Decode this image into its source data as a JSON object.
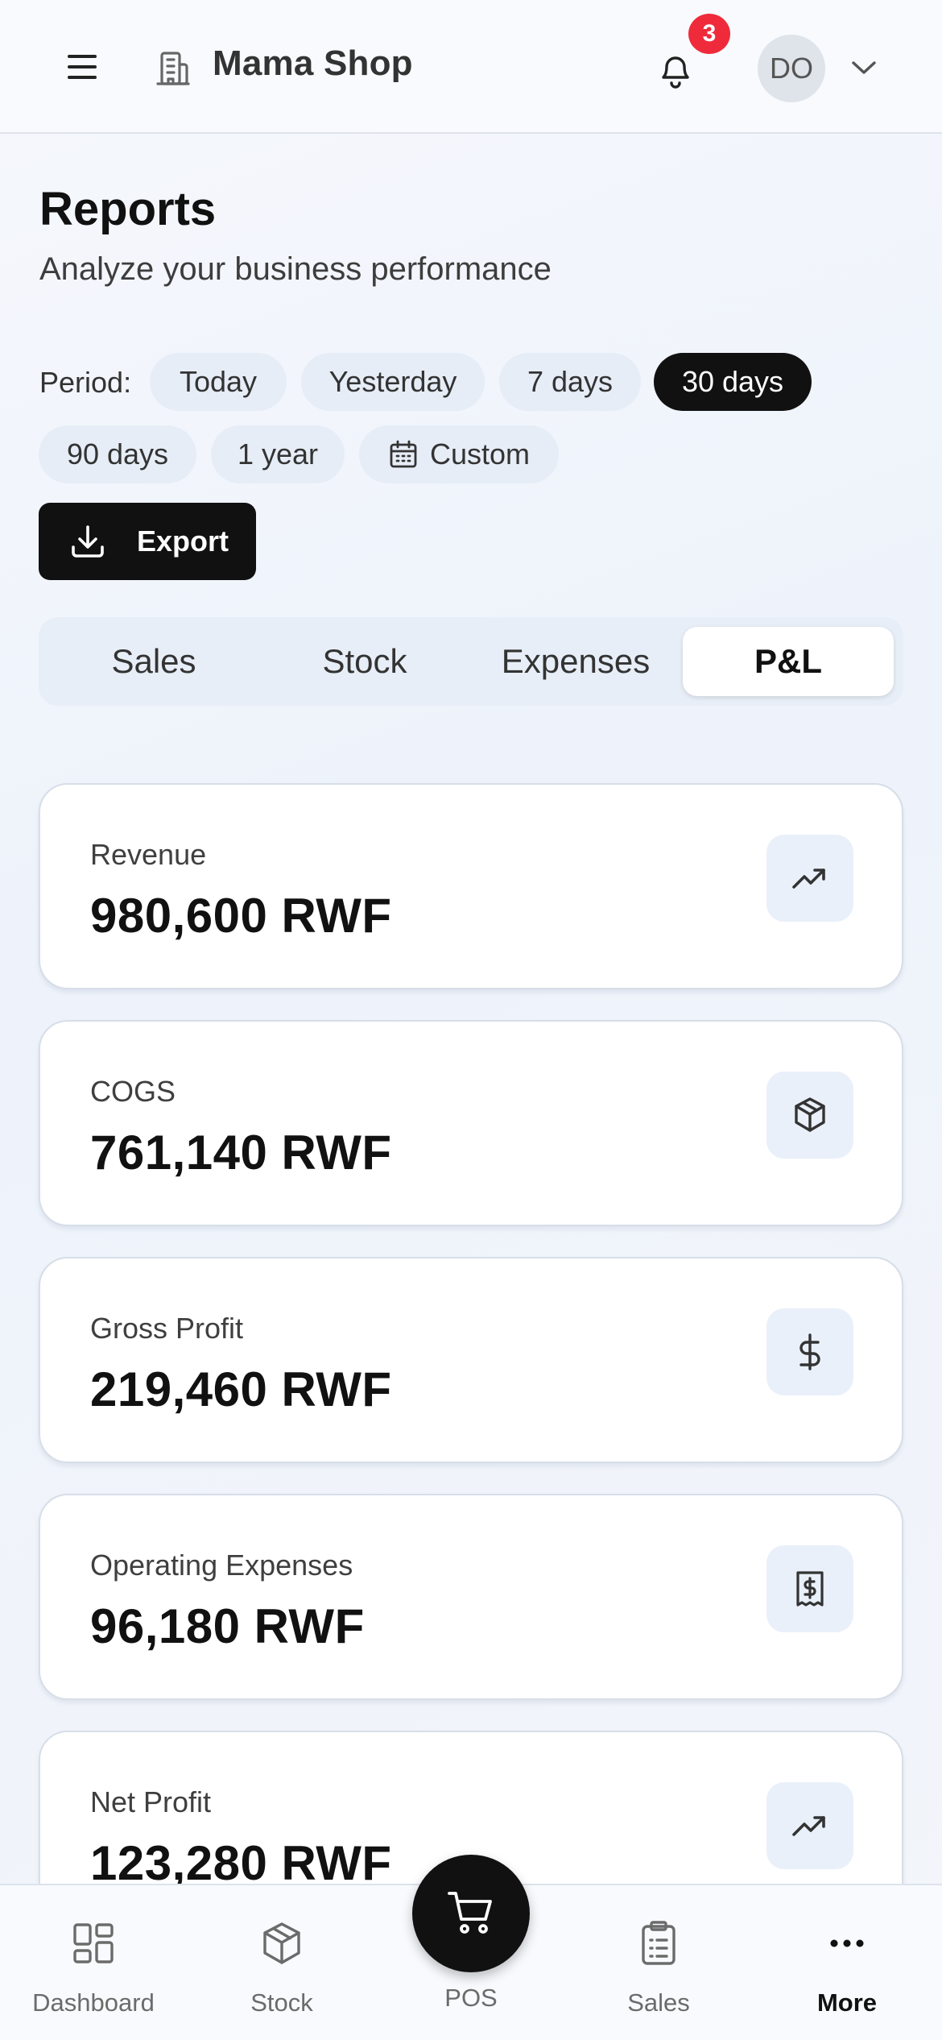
{
  "header": {
    "shop_name": "Mama Shop",
    "notification_count": "3",
    "avatar_initials": "DO"
  },
  "page": {
    "title": "Reports",
    "subtitle": "Analyze your business performance"
  },
  "period": {
    "label": "Period:",
    "options": [
      "Today",
      "Yesterday",
      "7 days",
      "30 days",
      "90 days",
      "1 year",
      "Custom"
    ],
    "selected": "30 days"
  },
  "export_label": "Export",
  "tabs": {
    "items": [
      "Sales",
      "Stock",
      "Expenses",
      "P&L"
    ],
    "active": "P&L"
  },
  "cards": [
    {
      "label": "Revenue",
      "value": "980,600 RWF",
      "icon": "trending-up-icon"
    },
    {
      "label": "COGS",
      "value": "761,140 RWF",
      "icon": "package-icon"
    },
    {
      "label": "Gross Profit",
      "value": "219,460 RWF",
      "icon": "dollar-icon"
    },
    {
      "label": "Operating Expenses",
      "value": "96,180 RWF",
      "icon": "receipt-icon"
    },
    {
      "label": "Net Profit",
      "value": "123,280 RWF",
      "icon": "trending-up-icon"
    }
  ],
  "bottom_nav": {
    "items": [
      "Dashboard",
      "Stock",
      "POS",
      "Sales",
      "More"
    ],
    "active": "More"
  },
  "colors": {
    "primary": "#111111",
    "badge": "#ef2b3b",
    "chip_bg": "#e6edf7",
    "icon_box_bg": "#e9f0fa"
  }
}
